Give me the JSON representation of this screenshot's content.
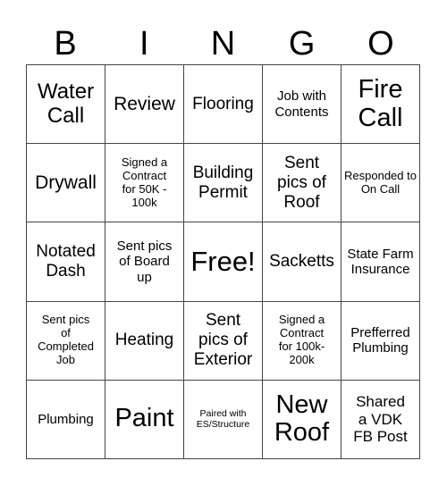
{
  "header": {
    "letters": [
      "B",
      "I",
      "N",
      "G",
      "O"
    ]
  },
  "cells": [
    [
      "Water Call",
      "Review",
      "Flooring",
      "Job with Contents",
      "Fire Call"
    ],
    [
      "Drywall",
      "Signed a Contract for 50K - 100k",
      "Building Permit",
      "Sent pics of Roof",
      "Responded to On Call"
    ],
    [
      "Notated Dash",
      "Sent pics of Board up",
      "Free!",
      "Sacketts",
      "State Farm Insurance"
    ],
    [
      "Sent pics of Completed Job",
      "Heating",
      "Sent pics of Exterior",
      "Signed a Contract for 100k-200k",
      "Prefferred Plumbing"
    ],
    [
      "Plumbing",
      "Paint",
      "Paired with ES/Structure",
      "New Roof",
      "Shared a VDK FB Post"
    ]
  ]
}
